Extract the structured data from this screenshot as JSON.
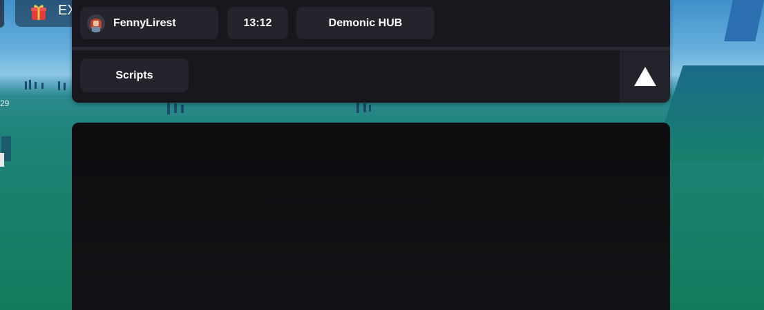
{
  "topbar": {
    "corner_label": "EX"
  },
  "side_number": "29",
  "hub": {
    "username": "FennyLirest",
    "time": "13:12",
    "title": "Demonic HUB",
    "tabs": [
      {
        "label": "Scripts",
        "active": true
      }
    ],
    "collapse_icon": "triangle-up-icon"
  },
  "colors": {
    "panel_bg": "#17171d",
    "chip_bg": "#24242c",
    "content_bg": "#0d0d10",
    "text": "#ffffff"
  }
}
